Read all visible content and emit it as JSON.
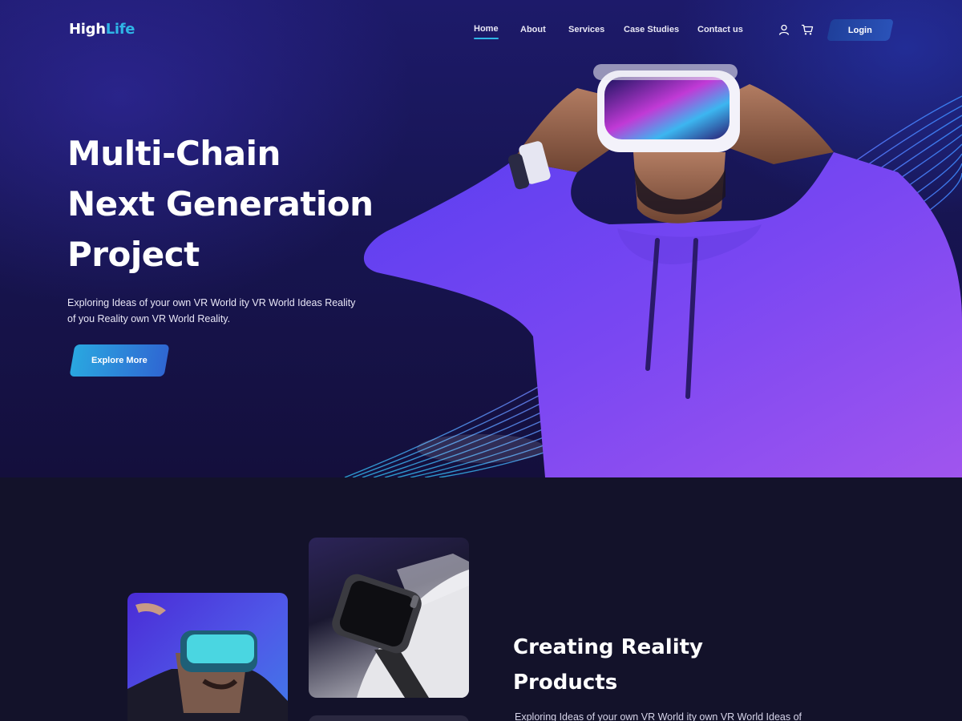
{
  "brand": {
    "name_part1": "High",
    "name_part2": "Life"
  },
  "nav": {
    "items": [
      {
        "label": "Home",
        "active": true
      },
      {
        "label": "About",
        "active": false
      },
      {
        "label": "Services",
        "active": false
      },
      {
        "label": "Case Studies",
        "active": false
      },
      {
        "label": "Contact us",
        "active": false
      }
    ],
    "user_icon": "user-icon",
    "cart_icon": "cart-icon",
    "login_label": "Login"
  },
  "hero": {
    "title_lines": [
      "Multi-Chain",
      "Next Generation",
      "Project"
    ],
    "description": "Exploring Ideas of your own VR World ity VR World Ideas Reality of you Reality own VR World Reality.",
    "cta_label": "Explore More"
  },
  "section2": {
    "title_lines": [
      "Creating Reality",
      "Products"
    ],
    "description": "Exploring Ideas of your own VR World ity own VR World Ideas of"
  },
  "colors": {
    "accent": "#2fb5e6",
    "hero_bg": "#171552",
    "section_bg": "#13122a",
    "button_gradient_start": "#2aa7e0",
    "button_gradient_end": "#2f66d2"
  }
}
